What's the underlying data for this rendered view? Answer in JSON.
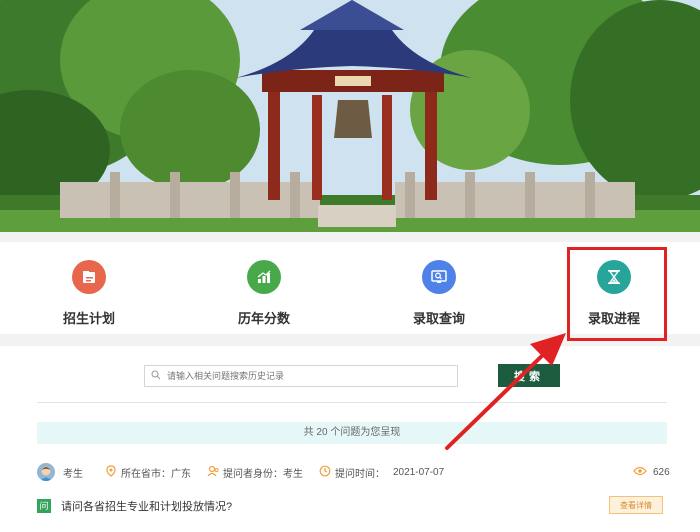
{
  "nav": {
    "items": [
      {
        "label": "招生计划",
        "icon": "document-icon",
        "color": "#e8674c"
      },
      {
        "label": "历年分数",
        "icon": "bar-chart-icon",
        "color": "#48a94a"
      },
      {
        "label": "录取查询",
        "icon": "search-monitor-icon",
        "color": "#4f82e8"
      },
      {
        "label": "录取进程",
        "icon": "hourglass-icon",
        "color": "#27a59a"
      }
    ]
  },
  "search": {
    "placeholder": "请输入相关问题搜索历史记录",
    "button_label": "搜索"
  },
  "question_count": "共 20 个问题为您呈现",
  "question": {
    "user": "考生",
    "city_label": "所在省市：广东",
    "identity_label": "提问者身份：考生",
    "time_label": "提问时间：",
    "time_value": "2021-07-07",
    "views": "626",
    "badge": "问",
    "text": "请问各省招生专业和计划投放情况?",
    "detail_button": "查看详情"
  },
  "colors": {
    "accent": "#1d5b3e",
    "highlight": "#e02222",
    "meta_icon": "#f0a23b"
  }
}
